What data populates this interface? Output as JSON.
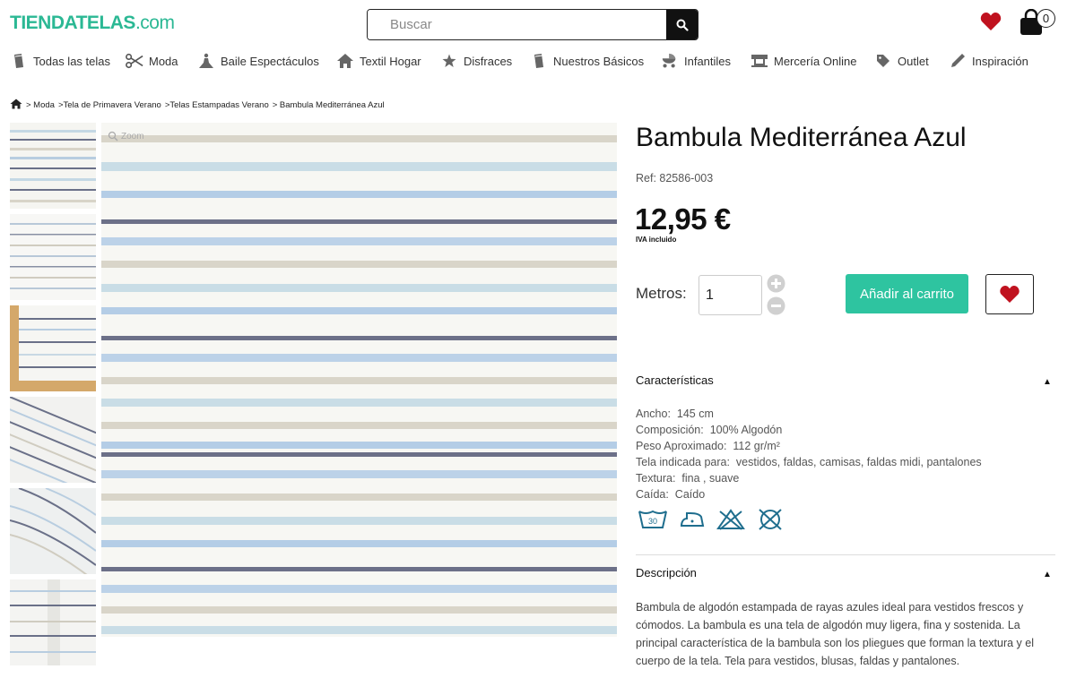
{
  "header": {
    "logo_main": "TIENDATELAS",
    "logo_suffix": ".com",
    "search_placeholder": "Buscar",
    "cart_count": "0"
  },
  "nav": [
    {
      "label": "Todas las telas",
      "icon": "fabric-roll-icon"
    },
    {
      "label": "Moda",
      "icon": "scissors-icon"
    },
    {
      "label": "Baile Espectáculos",
      "icon": "dancer-icon"
    },
    {
      "label": "Textil Hogar",
      "icon": "home-icon"
    },
    {
      "label": "Disfraces",
      "icon": "star-icon"
    },
    {
      "label": "Nuestros Básicos",
      "icon": "fabric-roll-icon"
    },
    {
      "label": "Infantiles",
      "icon": "baby-carriage-icon"
    },
    {
      "label": "Mercería Online",
      "icon": "sewing-machine-icon"
    },
    {
      "label": "Outlet",
      "icon": "tag-icon"
    },
    {
      "label": "Inspiración",
      "icon": "pencil-icon"
    }
  ],
  "breadcrumb": [
    "> Moda",
    ">Tela de Primavera Verano",
    ">Telas Estampadas Verano",
    "> Bambula Mediterránea Azul"
  ],
  "gallery": {
    "zoom_label": "Zoom"
  },
  "product": {
    "title": "Bambula Mediterránea Azul",
    "ref": "Ref: 82586-003",
    "price": "12,95 €",
    "iva": "IVA incluido",
    "qty_label": "Metros:",
    "qty_value": "1",
    "add_to_cart": "Añadir al carrito"
  },
  "characteristics": {
    "title": "Características",
    "rows": [
      {
        "label": "Ancho:",
        "value": "145 cm"
      },
      {
        "label": "Composición:",
        "value": "100% Algodón"
      },
      {
        "label": "Peso Aproximado:",
        "value": "112 gr/m²"
      },
      {
        "label": "Tela indicada para:",
        "value": "vestidos, faldas, camisas, faldas midi, pantalones"
      },
      {
        "label": "Textura:",
        "value": "fina   , suave"
      },
      {
        "label": "Caída:",
        "value": "Caído"
      }
    ],
    "care_icons": [
      "wash-30-icon",
      "iron-low-icon",
      "no-bleach-icon",
      "no-tumble-dry-icon"
    ],
    "wash_temp": "30"
  },
  "description": {
    "title": "Descripción",
    "text": "Bambula de algodón estampada de rayas azules ideal para vestidos frescos y cómodos. La bambula es una tela de algodón muy ligera, fina y sostenida. La principal característica de la bambula son los pliegues que forman la textura y el cuerpo de la tela. Tela para vestidos, blusas, faldas y pantalones."
  },
  "colors": {
    "accent": "#2ec4a0",
    "heart": "#c0121f"
  }
}
